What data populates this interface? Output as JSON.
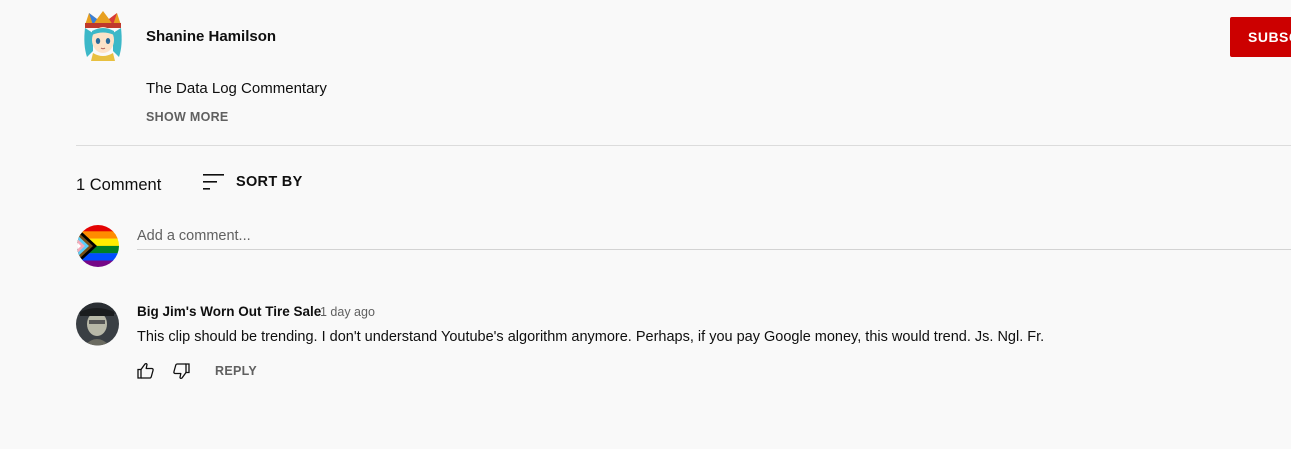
{
  "channel": {
    "name": "Shanine Hamilson",
    "subscribe_label": "SUBSCRIBE",
    "subscribe_color": "#cc0000",
    "avatar_icon": "anime-character-avatar"
  },
  "description": {
    "text": "The Data Log Commentary",
    "show_more_label": "SHOW MORE"
  },
  "comments_header": {
    "count_label": "1 Comment",
    "sort_label": "SORT BY",
    "sort_icon": "sort-lines-icon"
  },
  "add_comment": {
    "placeholder": "Add a comment...",
    "avatar_icon": "progress-pride-flag-avatar"
  },
  "comments": [
    {
      "author": "Big Jim's Worn Out Tire Sale",
      "time": "1 day ago",
      "text": "This clip should be trending. I don't understand Youtube's algorithm anymore. Perhaps, if you pay Google money, this would trend. Js. Ngl. Fr.",
      "avatar_icon": "person-photo-avatar",
      "reply_label": "REPLY",
      "like_icon": "thumbs-up-icon",
      "dislike_icon": "thumbs-down-icon"
    }
  ]
}
